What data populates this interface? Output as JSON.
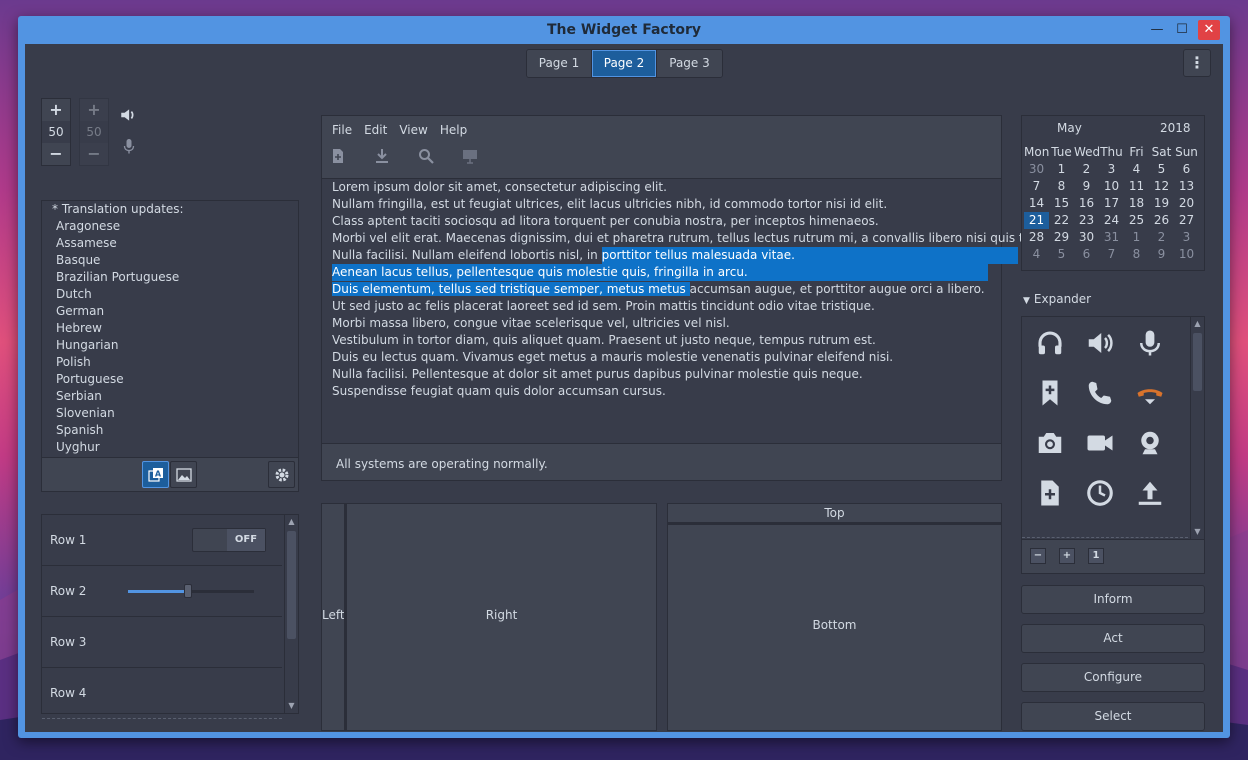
{
  "window": {
    "title": "The Widget Factory",
    "min": "—",
    "max": "☐",
    "close": "✕"
  },
  "tabs": [
    {
      "label": "Page 1"
    },
    {
      "label": "Page 2"
    },
    {
      "label": "Page 3"
    }
  ],
  "menu_button": "⋮",
  "spin1": {
    "plus": "+",
    "value": "50",
    "minus": "−"
  },
  "spin2": {
    "plus": "+",
    "value": "50",
    "minus": "−"
  },
  "language_list": {
    "header": "* Translation updates:",
    "items": [
      "Aragonese",
      "Assamese",
      "Basque",
      "Brazilian Portuguese",
      "Dutch",
      "German",
      "Hebrew",
      "Hungarian",
      "Polish",
      "Portuguese",
      "Serbian",
      "Slovenian",
      "Spanish",
      "Uyghur"
    ]
  },
  "rows": {
    "row1": {
      "label": "Row 1",
      "toggle": "OFF"
    },
    "row2": {
      "label": "Row 2",
      "slider": 0.48
    },
    "row3": {
      "label": "Row 3"
    },
    "row4": {
      "label": "Row 4"
    }
  },
  "editor": {
    "menu": [
      "File",
      "Edit",
      "View",
      "Help"
    ],
    "lines": [
      {
        "a": "Lorem ipsum dolor sit amet, consectetur adipiscing elit.",
        "s": "",
        "b": ""
      },
      {
        "a": "Nullam fringilla, est ut feugiat ultrices, elit lacus ultricies nibh, id commodo tortor nisi id elit.",
        "s": "",
        "b": ""
      },
      {
        "a": "Class aptent taciti sociosqu ad litora torquent per conubia nostra, per inceptos himenaeos.",
        "s": "",
        "b": ""
      },
      {
        "a": "Morbi vel elit erat. Maecenas dignissim, dui et pharetra rutrum, tellus lectus rutrum mi, a convallis libero nisi quis tellus.",
        "s": "",
        "b": ""
      },
      {
        "a": "Nulla facilisi. Nullam eleifend lobortis nisl, in ",
        "s": "porttitor tellus malesuada vitae.",
        "b": ""
      },
      {
        "a": "",
        "s": "Aenean lacus tellus, pellentesque quis molestie quis, fringilla in arcu.",
        "b": ""
      },
      {
        "a": "",
        "s": "Duis elementum, tellus sed tristique semper, metus metus ",
        "b": "accumsan augue, et porttitor augue orci a libero."
      },
      {
        "a": "Ut sed justo ac felis placerat laoreet sed id sem. Proin mattis tincidunt odio vitae tristique.",
        "s": "",
        "b": ""
      },
      {
        "a": "Morbi massa libero, congue vitae scelerisque vel, ultricies vel nisl.",
        "s": "",
        "b": ""
      },
      {
        "a": "Vestibulum in tortor diam, quis aliquet quam. Praesent ut justo neque, tempus rutrum est.",
        "s": "",
        "b": ""
      },
      {
        "a": "Duis eu lectus quam. Vivamus eget metus a mauris molestie venenatis pulvinar eleifend nisi.",
        "s": "",
        "b": ""
      },
      {
        "a": "Nulla facilisi. Pellentesque at dolor sit amet purus dapibus pulvinar molestie quis neque.",
        "s": "",
        "b": ""
      },
      {
        "a": "Suspendisse feugiat quam quis dolor accumsan cursus.",
        "s": "",
        "b": ""
      }
    ],
    "status": "All systems are operating normally."
  },
  "paned_h": {
    "left": "Left",
    "right": "Right"
  },
  "paned_v": {
    "top": "Top",
    "bottom": "Bottom"
  },
  "calendar": {
    "month": "May",
    "year": "2018",
    "weekdays": [
      "Mon",
      "Tue",
      "Wed",
      "Thu",
      "Fri",
      "Sat",
      "Sun"
    ],
    "days": [
      "30",
      "1",
      "2",
      "3",
      "4",
      "5",
      "6",
      "7",
      "8",
      "9",
      "10",
      "11",
      "12",
      "13",
      "14",
      "15",
      "16",
      "17",
      "18",
      "19",
      "20",
      "21",
      "22",
      "23",
      "24",
      "25",
      "26",
      "27",
      "28",
      "29",
      "30",
      "31",
      "1",
      "2",
      "3",
      "4",
      "5",
      "6",
      "7",
      "8",
      "9",
      "10"
    ],
    "selected": "21"
  },
  "expander": {
    "label": "Expander"
  },
  "icons": [
    "headphones-icon",
    "speaker-icon",
    "microphone-icon",
    "bookmark-add-icon",
    "phone-icon",
    "hangup-icon",
    "camera-photo-icon",
    "camera-video-icon",
    "webcam-icon",
    "document-new-icon",
    "clock-icon",
    "upload-icon"
  ],
  "buttons": {
    "inform": "Inform",
    "act": "Act",
    "configure": "Configure",
    "select": "Select"
  },
  "colors": {
    "accent": "#5294e2",
    "selection": "#0e72c8",
    "base": "#383c4a",
    "bg": "#404552",
    "hangup": "#d9732c"
  }
}
